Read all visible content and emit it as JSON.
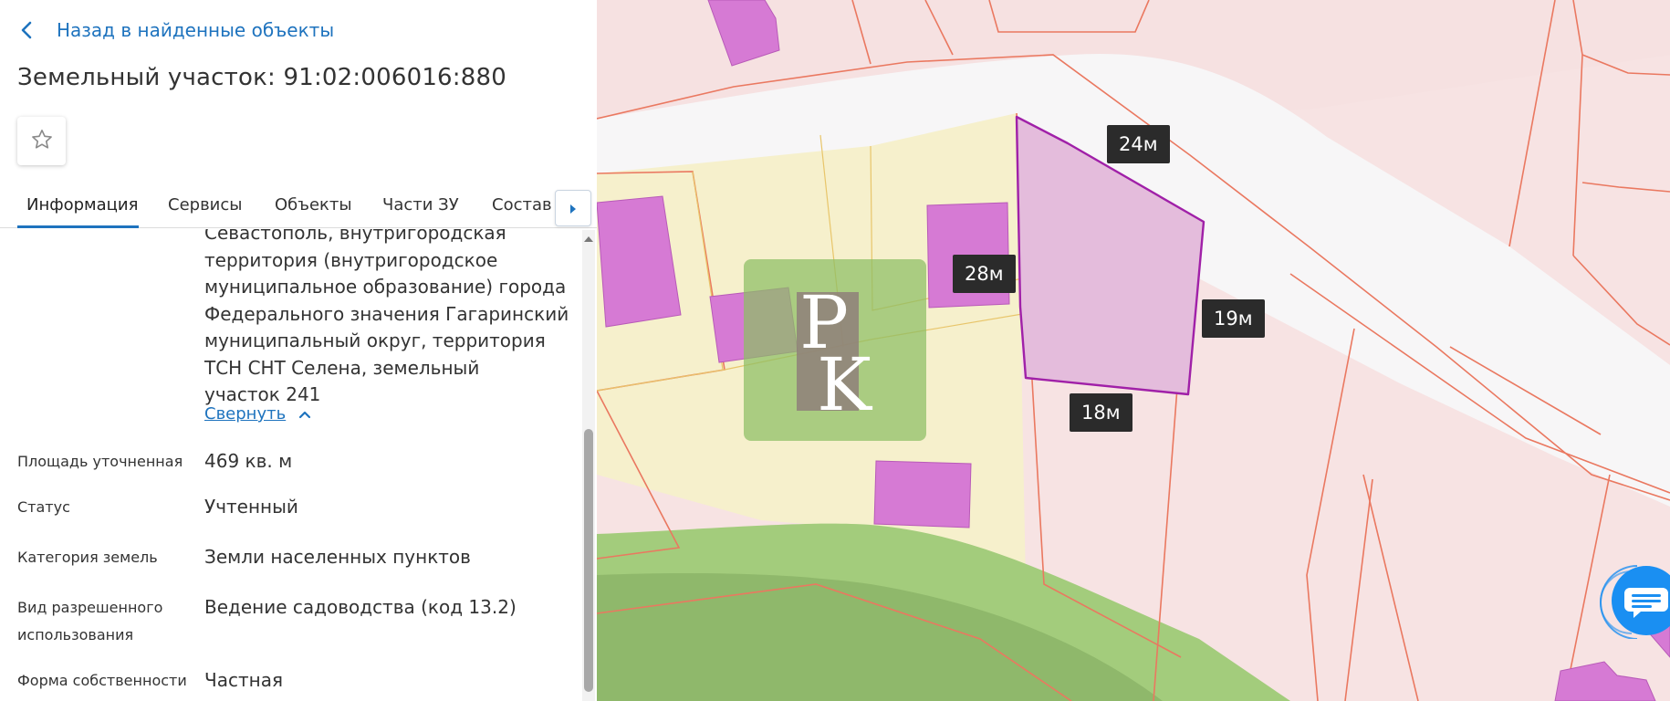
{
  "header": {
    "back_label": "Назад в найденные объекты",
    "title": "Земельный участок: 91:02:006016:880"
  },
  "tabs": [
    {
      "label": "Информация",
      "active": true
    },
    {
      "label": "Сервисы"
    },
    {
      "label": "Объекты"
    },
    {
      "label": "Части ЗУ"
    },
    {
      "label": "Состав"
    }
  ],
  "address": {
    "cut_line": "Севастополь, внутригородская",
    "lines": [
      "территория (внутригородское",
      "муниципальное образование) города",
      "Федерального значения Гагаринский",
      "муниципальный округ, территория",
      "ТСН СНТ Селена, земельный",
      "участок 241"
    ],
    "collapse_label": "Свернуть"
  },
  "fields": [
    {
      "label": "Площадь уточненная",
      "value": "469 кв. м"
    },
    {
      "label": "Статус",
      "value": "Учтенный"
    },
    {
      "label": "Категория земель",
      "value": "Земли населенных пунктов"
    },
    {
      "label": "Вид разрешенного",
      "label2": "использования",
      "value": "Ведение садоводства (код 13.2)"
    },
    {
      "label": "Форма собственности",
      "value": "Частная"
    }
  ],
  "map": {
    "measurements": [
      "24м",
      "28м",
      "19м",
      "18м"
    ],
    "logo_letters": [
      "P",
      "K"
    ]
  },
  "colors": {
    "accent": "#1e73be",
    "selected_parcel_fill": "#e4bcdc",
    "selected_parcel_stroke": "#a020a8",
    "building_fill": "#d67ad4",
    "boundary": "#ea7860",
    "green_zone": "#8fbf6a"
  },
  "icons": {
    "back": "chevron-left-icon",
    "favorite": "star-outline-icon",
    "tab_next": "caret-right-icon",
    "collapse": "chevron-up-icon",
    "chat": "chat-bubble-icon"
  }
}
